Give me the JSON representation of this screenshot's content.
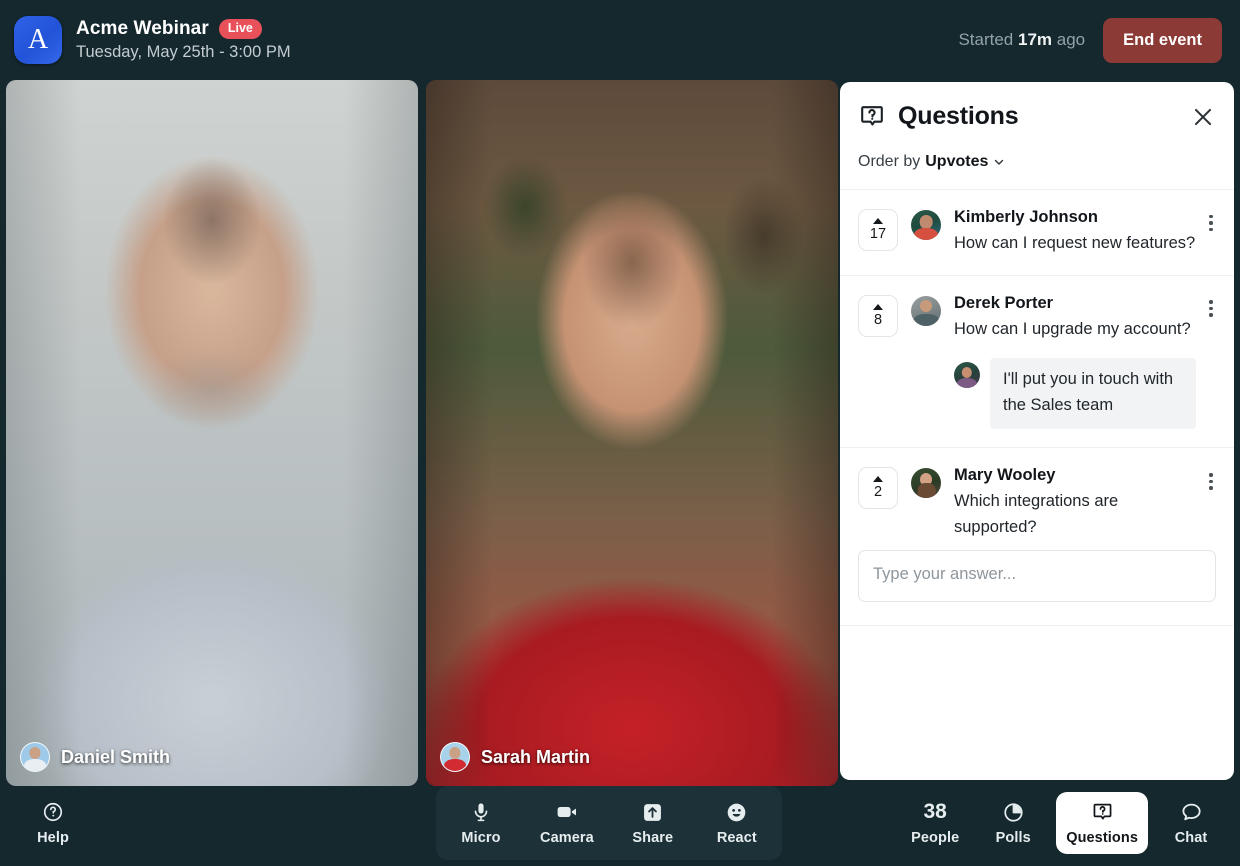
{
  "header": {
    "logo_letter": "A",
    "title": "Acme Webinar",
    "live_badge": "Live",
    "subtitle": "Tuesday, May 25th - 3:00 PM",
    "started_prefix": "Started",
    "started_value": "17m",
    "started_suffix": "ago",
    "end_event_label": "End event",
    "live_color": "#e8505a",
    "end_event_color": "#8c3a36",
    "logo_color": "#2253d8"
  },
  "stage": {
    "tiles": [
      {
        "name": "Daniel Smith"
      },
      {
        "name": "Sarah Martin"
      }
    ]
  },
  "questions_panel": {
    "icon": "question-box-icon",
    "title": "Questions",
    "close_icon": "close-icon",
    "order_label": "Order by",
    "order_value": "Upvotes",
    "items": [
      {
        "upvotes": "17",
        "author": "Kimberly Johnson",
        "text": "How can I request new features?",
        "reply": null
      },
      {
        "upvotes": "8",
        "author": "Derek Porter",
        "text": "How can I upgrade my account?",
        "reply": "I'll put you in touch with the Sales team"
      },
      {
        "upvotes": "2",
        "author": "Mary Wooley",
        "text": "Which integrations are supported?",
        "reply": null
      }
    ],
    "answer_placeholder": "Type your answer...",
    "answer_value": ""
  },
  "bottom_bar": {
    "help": {
      "label": "Help",
      "icon": "question-circle-icon"
    },
    "center": [
      {
        "label": "Micro",
        "icon": "microphone-icon"
      },
      {
        "label": "Camera",
        "icon": "video-camera-icon"
      },
      {
        "label": "Share",
        "icon": "share-upload-icon"
      },
      {
        "label": "React",
        "icon": "smiley-face-icon"
      }
    ],
    "right": [
      {
        "label": "People",
        "icon": "people-count",
        "count": "38",
        "active": false
      },
      {
        "label": "Polls",
        "icon": "pie-chart-icon",
        "active": false
      },
      {
        "label": "Questions",
        "icon": "question-box-icon",
        "active": true
      },
      {
        "label": "Chat",
        "icon": "chat-bubble-icon",
        "active": false
      }
    ]
  }
}
